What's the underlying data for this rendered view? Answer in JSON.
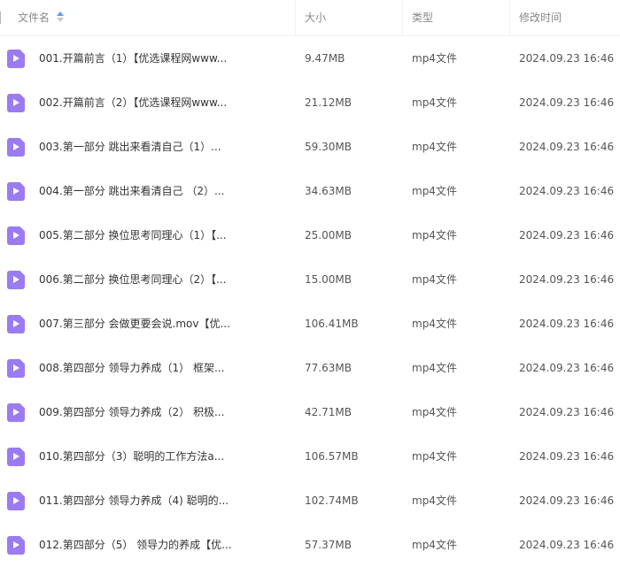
{
  "columns": {
    "name": "文件名",
    "size": "大小",
    "type": "类型",
    "modified": "修改时间"
  },
  "icons": {
    "sort": "sort-ascending-icon",
    "file": "video-file-icon"
  },
  "colors": {
    "video_icon": "#9b7bf0",
    "sort_active": "#5b9cf5"
  },
  "files": [
    {
      "name": "001.开篇前言（1）【优选课程网www...",
      "size": "9.47MB",
      "type": "mp4文件",
      "modified": "2024.09.23 16:46"
    },
    {
      "name": "002.开篇前言（2）【优选课程网www...",
      "size": "21.12MB",
      "type": "mp4文件",
      "modified": "2024.09.23 16:46"
    },
    {
      "name": "003.第一部分 跳出来看清自己（1）...",
      "size": "59.30MB",
      "type": "mp4文件",
      "modified": "2024.09.23 16:46"
    },
    {
      "name": "004.第一部分 跳出来看清自己 （2）...",
      "size": "34.63MB",
      "type": "mp4文件",
      "modified": "2024.09.23 16:46"
    },
    {
      "name": "005.第二部分 换位思考同理心（1）【...",
      "size": "25.00MB",
      "type": "mp4文件",
      "modified": "2024.09.23 16:46"
    },
    {
      "name": "006.第二部分 换位思考同理心（2）【...",
      "size": "15.00MB",
      "type": "mp4文件",
      "modified": "2024.09.23 16:46"
    },
    {
      "name": "007.第三部分 会做更要会说.mov【优...",
      "size": "106.41MB",
      "type": "mp4文件",
      "modified": "2024.09.23 16:46"
    },
    {
      "name": "008.第四部分 领导力养成（1） 框架...",
      "size": "77.63MB",
      "type": "mp4文件",
      "modified": "2024.09.23 16:46"
    },
    {
      "name": "009.第四部分 领导力养成（2） 积极...",
      "size": "42.71MB",
      "type": "mp4文件",
      "modified": "2024.09.23 16:46"
    },
    {
      "name": "010.第四部分（3）聪明的工作方法a...",
      "size": "106.57MB",
      "type": "mp4文件",
      "modified": "2024.09.23 16:46"
    },
    {
      "name": "011.第四部分 领导力养成（4) 聪明的...",
      "size": "102.74MB",
      "type": "mp4文件",
      "modified": "2024.09.23 16:46"
    },
    {
      "name": "012.第四部分（5） 领导力的养成【优...",
      "size": "57.37MB",
      "type": "mp4文件",
      "modified": "2024.09.23 16:46"
    }
  ]
}
